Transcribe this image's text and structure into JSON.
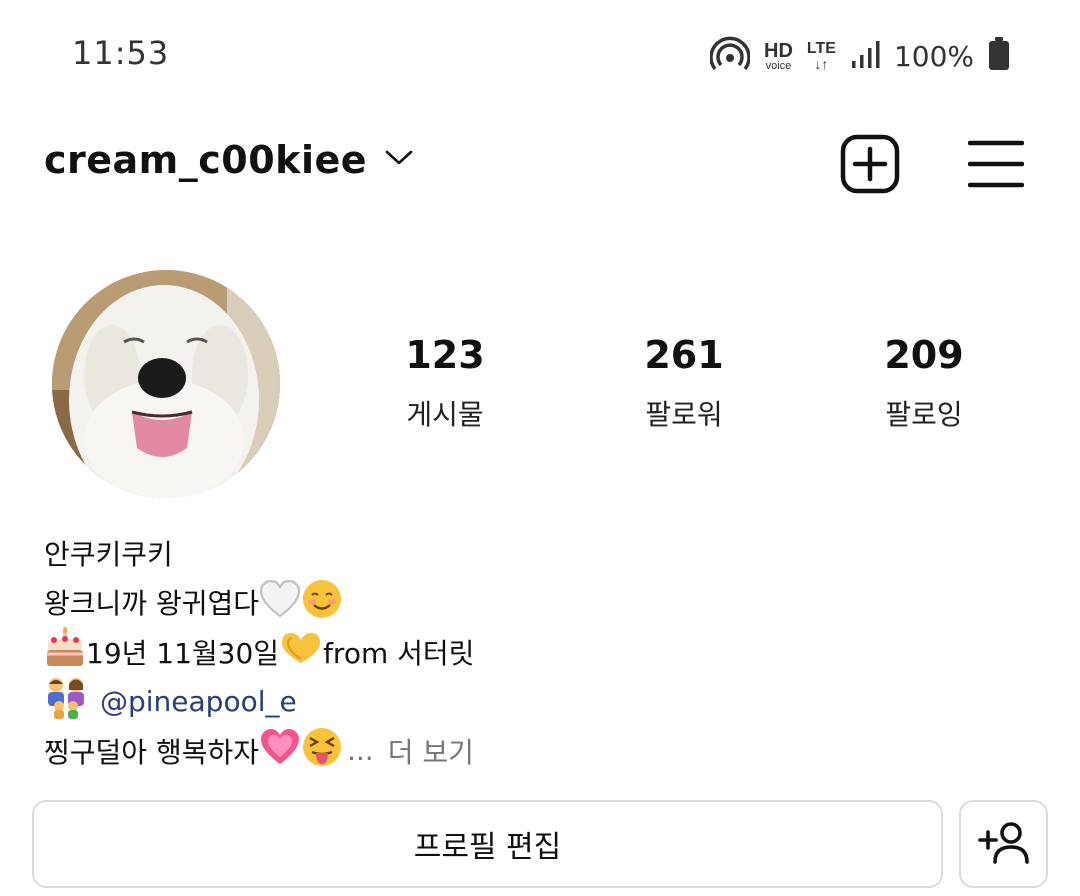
{
  "status_bar": {
    "time": "11:53",
    "hd_label": "HD",
    "voice_label": "voice",
    "lte_label": "LTE",
    "lte_arrows": "↓↑",
    "battery_percent": "100%"
  },
  "header": {
    "username": "cream_c00kiee"
  },
  "profile": {
    "stats": [
      {
        "count": "123",
        "label": "게시물"
      },
      {
        "count": "261",
        "label": "팔로워"
      },
      {
        "count": "209",
        "label": "팔로잉"
      }
    ]
  },
  "bio": {
    "name": "안쿠키쿠키",
    "line2_text": "왕크니까 왕귀엽다",
    "line3_a": "19년 11월30일",
    "line3_b": "from 서터릿",
    "mention": "@pineapool_e",
    "line5_text": "찡구덜아 행복하자",
    "line5_ellipsis": "...",
    "more_label": "더 보기"
  },
  "actions": {
    "edit_profile_label": "프로필 편집"
  },
  "colors": {
    "text": "#111111",
    "mention": "#2c3e7a",
    "muted": "#777777",
    "button_border": "#dcdcdc"
  }
}
